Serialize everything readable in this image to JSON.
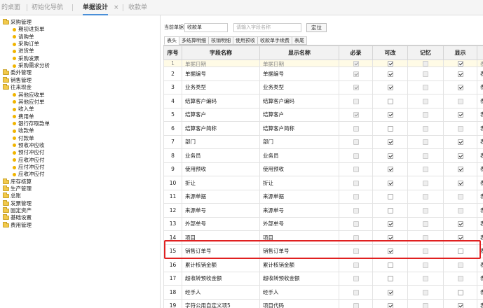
{
  "tabs": [
    {
      "label": "的桌面"
    },
    {
      "label": "初始化导航"
    },
    {
      "label": "单据设计"
    },
    {
      "label": "收款单"
    }
  ],
  "tab_close": "×",
  "tree": [
    {
      "label": "采购管理",
      "kind": "folder",
      "level": 0
    },
    {
      "label": "期初进货单",
      "kind": "leaf",
      "level": 1
    },
    {
      "label": "请购单",
      "kind": "leaf",
      "level": 1
    },
    {
      "label": "采购订单",
      "kind": "leaf",
      "level": 1
    },
    {
      "label": "进货单",
      "kind": "leaf",
      "level": 1
    },
    {
      "label": "采购发票",
      "kind": "leaf",
      "level": 1
    },
    {
      "label": "采购需求分析",
      "kind": "leaf",
      "level": 1
    },
    {
      "label": "委外管理",
      "kind": "folder",
      "level": 0
    },
    {
      "label": "销售管理",
      "kind": "folder",
      "level": 0
    },
    {
      "label": "往来现金",
      "kind": "folder",
      "level": 0
    },
    {
      "label": "其他应收单",
      "kind": "leaf",
      "level": 1
    },
    {
      "label": "其他应付单",
      "kind": "leaf",
      "level": 1
    },
    {
      "label": "收入单",
      "kind": "leaf",
      "level": 1
    },
    {
      "label": "费用单",
      "kind": "leaf",
      "level": 1
    },
    {
      "label": "银行存取款单",
      "kind": "leaf",
      "level": 1
    },
    {
      "label": "收款单",
      "kind": "leaf",
      "level": 1
    },
    {
      "label": "付款单",
      "kind": "leaf",
      "level": 1
    },
    {
      "label": "预收冲应收",
      "kind": "leaf",
      "level": 1
    },
    {
      "label": "预付冲应付",
      "kind": "leaf",
      "level": 1
    },
    {
      "label": "应收冲应付",
      "kind": "leaf",
      "level": 1
    },
    {
      "label": "应付冲应付",
      "kind": "leaf",
      "level": 1
    },
    {
      "label": "应收冲应付",
      "kind": "leaf",
      "level": 1
    },
    {
      "label": "库存核算",
      "kind": "folder",
      "level": 0
    },
    {
      "label": "生产管理",
      "kind": "folder",
      "level": 0
    },
    {
      "label": "总账",
      "kind": "folder",
      "level": 0
    },
    {
      "label": "发票管理",
      "kind": "folder",
      "level": 0
    },
    {
      "label": "固定资产",
      "kind": "folder",
      "level": 0
    },
    {
      "label": "基础设置",
      "kind": "folder",
      "level": 0
    },
    {
      "label": "费用管理",
      "kind": "folder",
      "level": 0
    }
  ],
  "filter": {
    "label": "当前单据",
    "doc_value": "收款单",
    "field_placeholder": "请输入字段名称",
    "locate_button": "定位"
  },
  "subtabs": [
    "表头",
    "多结算明细",
    "核销明细",
    "使用预收",
    "收款单手续费",
    "表尾"
  ],
  "columns": [
    "序号",
    "字段名称",
    "显示名称",
    "必录",
    "可改",
    "记忆",
    "显示",
    "页签"
  ],
  "rows": [
    {
      "no": "1",
      "field": "单据日期",
      "display": "单据日期",
      "req": true,
      "edit": true,
      "mem": false,
      "show": true,
      "tab": "表头",
      "partial": true
    },
    {
      "no": "2",
      "field": "单据编号",
      "display": "单据编号",
      "req": true,
      "edit": true,
      "mem": false,
      "show": true,
      "tab": "表头"
    },
    {
      "no": "3",
      "field": "业务类型",
      "display": "业务类型",
      "req": true,
      "edit": true,
      "mem": false,
      "show": true,
      "tab": "表头"
    },
    {
      "no": "4",
      "field": "结算客户编码",
      "display": "结算客户编码",
      "req": false,
      "edit": false,
      "mem": false,
      "show": false,
      "tab": "表头"
    },
    {
      "no": "5",
      "field": "结算客户",
      "display": "结算客户",
      "req": true,
      "edit": true,
      "mem": false,
      "show": true,
      "tab": "表头"
    },
    {
      "no": "6",
      "field": "结算客户简称",
      "display": "结算客户简称",
      "req": false,
      "edit": false,
      "mem": false,
      "show": false,
      "tab": "表头"
    },
    {
      "no": "7",
      "field": "部门",
      "display": "部门",
      "req": false,
      "edit": true,
      "mem": false,
      "show": true,
      "tab": "表头"
    },
    {
      "no": "8",
      "field": "业务员",
      "display": "业务员",
      "req": false,
      "edit": true,
      "mem": false,
      "show": true,
      "tab": "表头"
    },
    {
      "no": "9",
      "field": "使用预收",
      "display": "使用预收",
      "req": false,
      "edit": true,
      "mem": false,
      "show": true,
      "tab": "表头"
    },
    {
      "no": "10",
      "field": "折让",
      "display": "折让",
      "req": false,
      "edit": true,
      "mem": false,
      "show": true,
      "tab": "表头"
    },
    {
      "no": "11",
      "field": "来源单据",
      "display": "来源单据",
      "req": false,
      "edit": false,
      "mem": false,
      "show": false,
      "tab": "表头"
    },
    {
      "no": "12",
      "field": "来源单号",
      "display": "来源单号",
      "req": false,
      "edit": false,
      "mem": false,
      "show": false,
      "tab": "表头"
    },
    {
      "no": "13",
      "field": "外部单号",
      "display": "外部单号",
      "req": false,
      "edit": true,
      "mem": false,
      "show": true,
      "tab": "表头"
    },
    {
      "no": "14",
      "field": "项目",
      "display": "项目",
      "req": false,
      "edit": true,
      "mem": false,
      "show": true,
      "tab": "表头"
    },
    {
      "no": "15",
      "field": "销售订单号",
      "display": "销售订单号",
      "req": false,
      "edit": true,
      "mem": false,
      "show": false,
      "tab": "表头"
    },
    {
      "no": "16",
      "field": "累计核销金额",
      "display": "累计核销金额",
      "req": false,
      "edit": false,
      "mem": false,
      "show": false,
      "tab": "表头"
    },
    {
      "no": "17",
      "field": "超收转预收金额",
      "display": "超收转预收金额",
      "req": false,
      "edit": false,
      "mem": false,
      "show": false,
      "tab": "表头"
    },
    {
      "no": "18",
      "field": "经手人",
      "display": "经手人",
      "req": false,
      "edit": true,
      "mem": false,
      "show": false,
      "tab": "表头"
    },
    {
      "no": "19",
      "field": "字符公用自定义项5",
      "display": "项目代码",
      "req": false,
      "edit": true,
      "mem": false,
      "show": true,
      "tab": "表头"
    }
  ]
}
